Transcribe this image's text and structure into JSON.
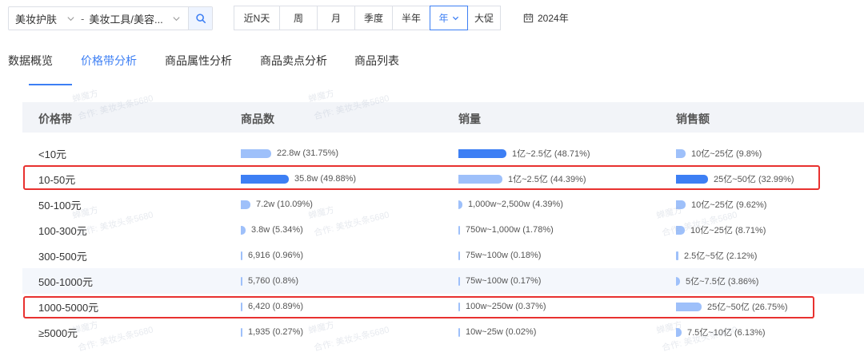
{
  "filters": {
    "category_primary": "美妆护肤",
    "category_separator": "-",
    "category_secondary": "美妆工具/美容...",
    "periods": [
      "近N天",
      "周",
      "月",
      "季度",
      "半年",
      "年",
      "大促"
    ],
    "active_period": "年",
    "year": "2024年"
  },
  "tabs": [
    {
      "label": "数据概览"
    },
    {
      "label": "价格带分析"
    },
    {
      "label": "商品属性分析"
    },
    {
      "label": "商品卖点分析"
    },
    {
      "label": "商品列表"
    }
  ],
  "active_tab": "价格带分析",
  "table": {
    "headers": [
      "价格带",
      "商品数",
      "销量",
      "销售额"
    ],
    "rows": [
      {
        "band": "<10元",
        "count": {
          "text": "22.8w (31.75%)",
          "share": 31.75
        },
        "volume": {
          "text": "1亿~2.5亿 (48.71%)",
          "share": 48.71
        },
        "sales": {
          "text": "10亿~25亿 (9.8%)",
          "share": 9.8
        }
      },
      {
        "band": "10-50元",
        "count": {
          "text": "35.8w (49.88%)",
          "share": 49.88
        },
        "volume": {
          "text": "1亿~2.5亿 (44.39%)",
          "share": 44.39
        },
        "sales": {
          "text": "25亿~50亿 (32.99%)",
          "share": 32.99
        }
      },
      {
        "band": "50-100元",
        "count": {
          "text": "7.2w (10.09%)",
          "share": 10.09
        },
        "volume": {
          "text": "1,000w~2,500w (4.39%)",
          "share": 4.39
        },
        "sales": {
          "text": "10亿~25亿 (9.62%)",
          "share": 9.62
        }
      },
      {
        "band": "100-300元",
        "count": {
          "text": "3.8w (5.34%)",
          "share": 5.34
        },
        "volume": {
          "text": "750w~1,000w (1.78%)",
          "share": 1.78
        },
        "sales": {
          "text": "10亿~25亿 (8.71%)",
          "share": 8.71
        }
      },
      {
        "band": "300-500元",
        "count": {
          "text": "6,916 (0.96%)",
          "share": 0.96
        },
        "volume": {
          "text": "75w~100w (0.18%)",
          "share": 0.18
        },
        "sales": {
          "text": "2.5亿~5亿 (2.12%)",
          "share": 2.12
        }
      },
      {
        "band": "500-1000元",
        "count": {
          "text": "5,760 (0.8%)",
          "share": 0.8
        },
        "volume": {
          "text": "75w~100w (0.17%)",
          "share": 0.17
        },
        "sales": {
          "text": "5亿~7.5亿 (3.86%)",
          "share": 3.86
        }
      },
      {
        "band": "1000-5000元",
        "count": {
          "text": "6,420 (0.89%)",
          "share": 0.89
        },
        "volume": {
          "text": "100w~250w (0.37%)",
          "share": 0.37
        },
        "sales": {
          "text": "25亿~50亿 (26.75%)",
          "share": 26.75
        }
      },
      {
        "band": "≥5000元",
        "count": {
          "text": "1,935 (0.27%)",
          "share": 0.27
        },
        "volume": {
          "text": "10w~25w (0.02%)",
          "share": 0.02
        },
        "sales": {
          "text": "7.5亿~10亿 (6.13%)",
          "share": 6.13
        }
      }
    ],
    "highlighted_rows": [
      "10-50元",
      "1000-5000元"
    ]
  },
  "colors": {
    "accent": "#3d7ff4",
    "bar_top": "#3d7ff4",
    "bar_other": "#9ec0fa",
    "highlight": "#e8312f",
    "header_bg": "#f2f4f8"
  },
  "watermarks": [
    "蝉魔方",
    "合作: 美妆头条5680"
  ]
}
